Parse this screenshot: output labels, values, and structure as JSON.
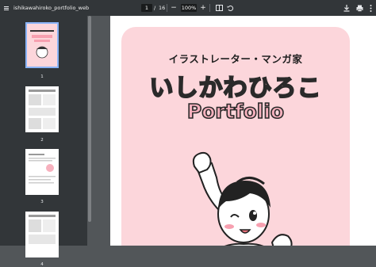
{
  "toolbar": {
    "title": "ishikawahiroko_portfolio_web",
    "page_current": "1",
    "page_separator": "/",
    "page_total": "16",
    "zoom_out": "−",
    "zoom_value": "100%",
    "zoom_in": "+",
    "icons": [
      "menu-icon",
      "fit-page-icon",
      "rotate-icon",
      "download-icon",
      "print-icon",
      "more-icon"
    ]
  },
  "sidebar": {
    "thumbnails": [
      {
        "number": "1"
      },
      {
        "number": "2"
      },
      {
        "number": "3"
      },
      {
        "number": "4"
      }
    ]
  },
  "document": {
    "subtitle": "イラストレーター・マンガ家",
    "name": "いしかわひろこ",
    "heading": "Portfolio"
  },
  "colors": {
    "toolbar": "#323639",
    "viewer_bg": "#525659",
    "cover_pink": "#fcd6db",
    "title_pink": "#f7b1be",
    "selection": "#8ab4f8"
  }
}
